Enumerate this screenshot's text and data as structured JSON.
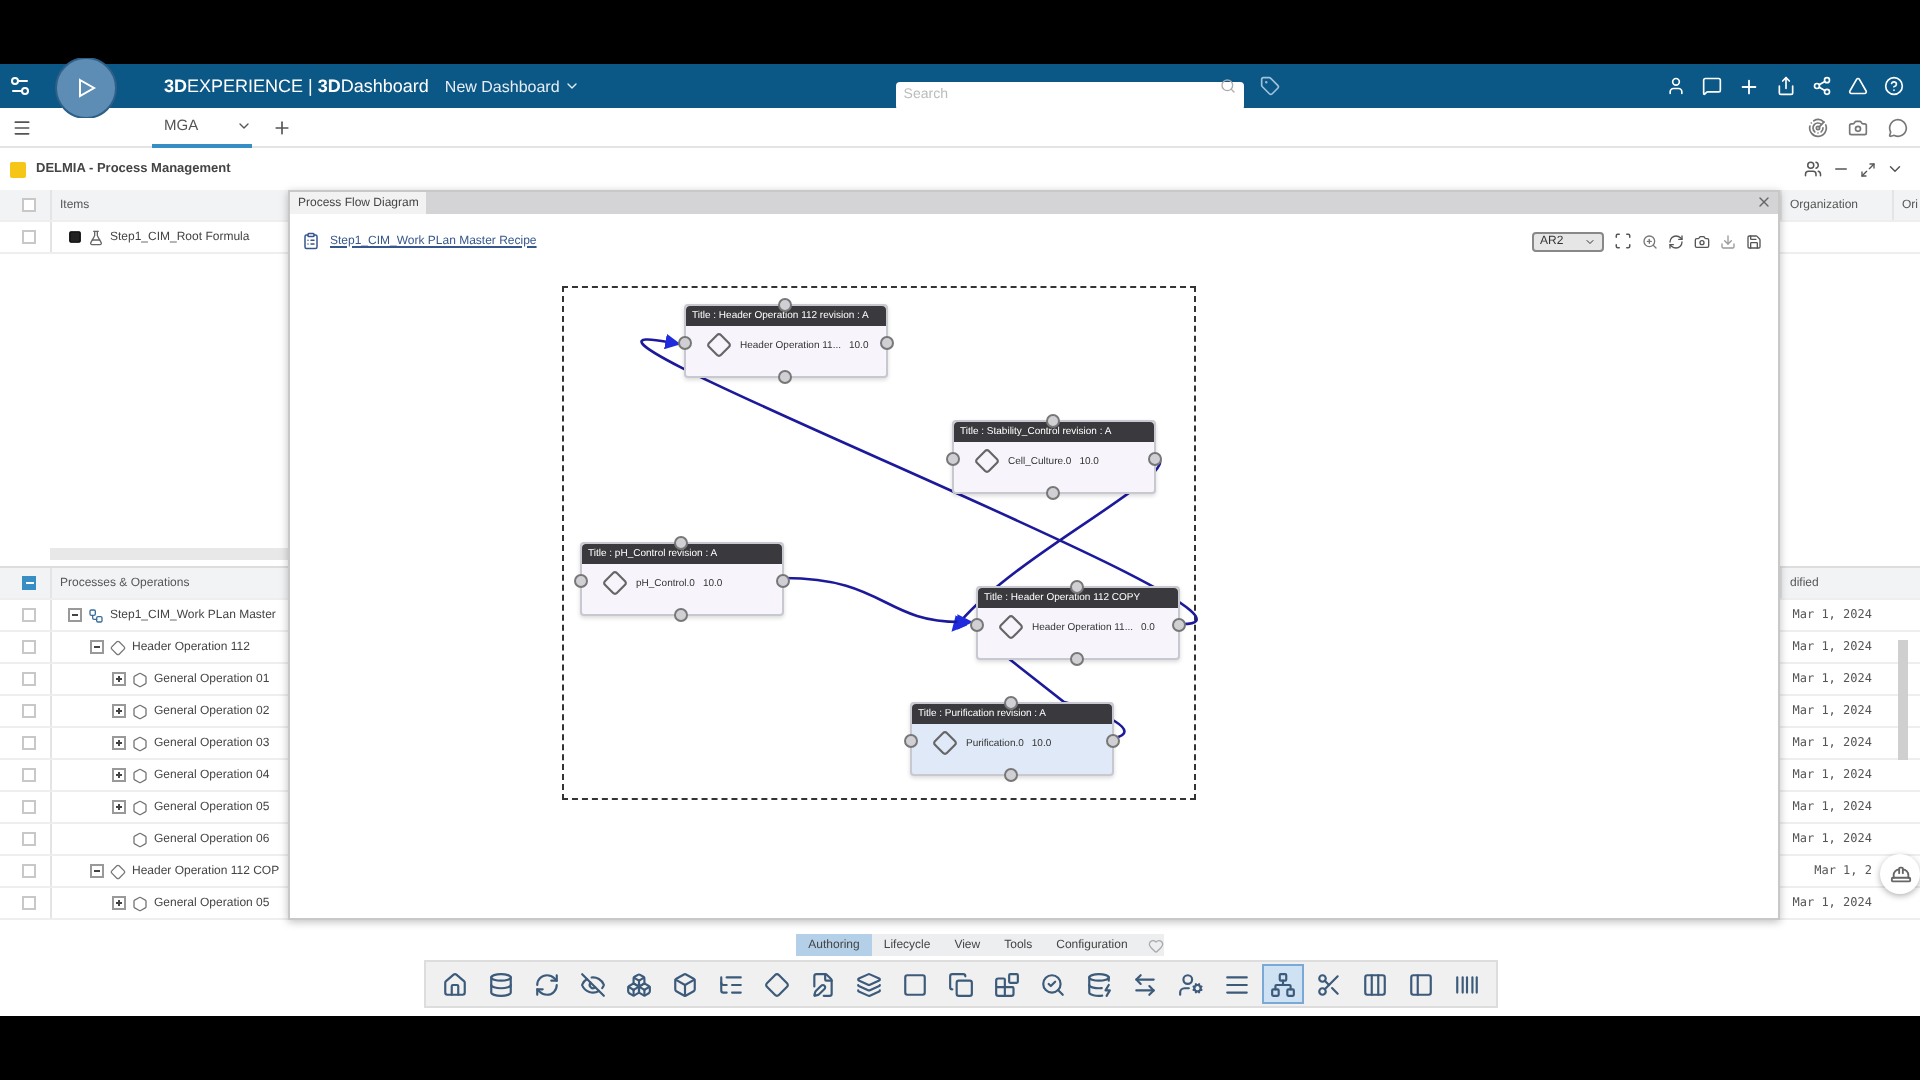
{
  "topbar": {
    "brand": "**3D**EXPERIENCE | **3D**Dashboard",
    "dashboard": "New Dashboard",
    "search": {
      "placeholder": "Search"
    }
  },
  "tabs": [
    {
      "label": "MGA",
      "selected": true
    }
  ],
  "app": {
    "title": "DELMIA - Process Management"
  },
  "items": {
    "checked": false,
    "columns": [
      "Items",
      "Organization",
      "Ori"
    ],
    "rows": [
      {
        "label": "Step1_CIM_Root Formula",
        "checked": false
      }
    ]
  },
  "processes": {
    "title": "Processes & Operations",
    "checked": true,
    "column": "dified",
    "rows": [
      {
        "label": "Step1_CIM_Work PLan Master",
        "kind": "plan",
        "expanded": true,
        "checked": false,
        "modified": "Mar 1, 2024",
        "children": [
          {
            "label": "Header Operation 112",
            "kind": "header",
            "expanded": true,
            "checked": false,
            "modified": "Mar 1, 2024",
            "children": [
              {
                "label": "General Operation 01",
                "kind": "operation",
                "expanded": false,
                "checked": false,
                "modified": "Mar 1, 2024"
              },
              {
                "label": "General Operation 02",
                "kind": "operation",
                "expanded": false,
                "checked": false,
                "modified": "Mar 1, 2024"
              },
              {
                "label": "General Operation 03",
                "kind": "operation",
                "expanded": false,
                "checked": false,
                "modified": "Mar 1, 2024"
              },
              {
                "label": "General Operation 04",
                "kind": "operation",
                "expanded": false,
                "checked": false,
                "modified": "Mar 1, 2024"
              },
              {
                "label": "General Operation 05",
                "kind": "operation",
                "expanded": false,
                "checked": false,
                "modified": "Mar 1, 2024"
              },
              {
                "label": "General Operation 06",
                "kind": "operation",
                "checked": false,
                "modified": "Mar 1, 2024"
              }
            ]
          },
          {
            "label": "Header Operation 112 COP",
            "kind": "header",
            "expanded": true,
            "checked": false,
            "modified": "Mar 1, 2",
            "children": [
              {
                "label": "General Operation 05",
                "kind": "operation",
                "expanded": false,
                "checked": false,
                "modified": "Mar 1, 2024"
              }
            ]
          }
        ]
      }
    ]
  },
  "dialog": {
    "title": "Process Flow Diagram",
    "link": "Step1_CIM_Work PLan Master Recipe",
    "view": "AR2",
    "nodes": [
      {
        "title": "Title : Header Operation 112  revision : A",
        "label": "Header Operation 11...",
        "value": "10.0",
        "selected": false
      },
      {
        "title": "Title : Stability_Control  revision : A",
        "label": "Cell_Culture.0",
        "value": "10.0",
        "selected": false
      },
      {
        "title": "Title : pH_Control  revision : A",
        "label": "pH_Control.0",
        "value": "10.0",
        "selected": false
      },
      {
        "title": "Title : Header Operation 112 COPY",
        "label": "Header Operation 11...",
        "value": "0.0",
        "selected": false
      },
      {
        "title": "Title : Purification  revision : A",
        "label": "Purification.0",
        "value": "10.0",
        "selected": true
      }
    ]
  },
  "action_tabs": [
    {
      "label": "Authoring",
      "selected": true
    },
    {
      "label": "Lifecycle",
      "selected": false
    },
    {
      "label": "View",
      "selected": false
    },
    {
      "label": "Tools",
      "selected": false
    },
    {
      "label": "Configuration",
      "selected": false
    }
  ],
  "toolbar": [
    {
      "selected": false
    },
    {
      "selected": false
    },
    {
      "selected": false
    },
    {
      "selected": false
    },
    {
      "selected": false
    },
    {
      "selected": false
    },
    {
      "selected": false
    },
    {
      "selected": false
    },
    {
      "selected": false
    },
    {
      "selected": false
    },
    {
      "selected": false
    },
    {
      "selected": false
    },
    {
      "selected": false
    },
    {
      "selected": false
    },
    {
      "selected": false
    },
    {
      "selected": false
    },
    {
      "selected": false
    },
    {
      "selected": false
    },
    {
      "selected": true
    },
    {
      "selected": false
    },
    {
      "selected": false
    },
    {
      "selected": false
    },
    {
      "selected": false
    }
  ]
}
